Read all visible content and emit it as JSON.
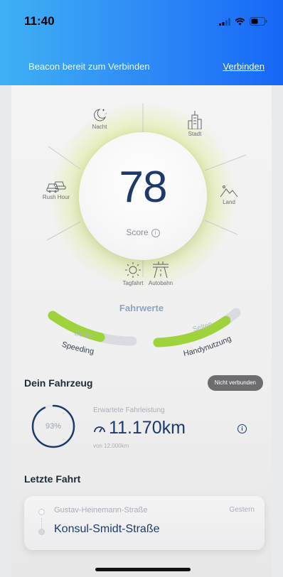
{
  "status_bar": {
    "time": "11:40"
  },
  "header": {
    "beacon_text": "Beacon bereit zum Verbinden",
    "connect_label": "Verbinden"
  },
  "score": {
    "value": "78",
    "label": "Score"
  },
  "categories": {
    "night": "Nacht",
    "city": "Stadt",
    "rush_hour": "Rush Hour",
    "land": "Land",
    "day": "Tagfahrt",
    "highway": "Autobahn"
  },
  "fahrwerte": {
    "title": "Fahrwerte",
    "speeding": {
      "label": "Speeding",
      "rating": "Selten",
      "level": 0.62
    },
    "phone_usage": {
      "label": "Handynutzung",
      "rating": "Selten",
      "level": 0.85
    }
  },
  "vehicle": {
    "title": "Dein Fahrzeug",
    "status_badge": "Nicht verbunden",
    "progress_percent_label": "93%",
    "progress": 0.93,
    "expected_label": "Erwartete Fahrleistung",
    "expected_value": "11.170km",
    "expected_sub": "von 12.000km"
  },
  "last_trip": {
    "title": "Letzte Fahrt",
    "from": "Gustav-Heinemann-Straße",
    "to": "Konsul-Smidt-Straße",
    "when": "Gestern"
  },
  "colors": {
    "accent": "#1d3a6b",
    "green": "#9fd33b",
    "header_start": "#3fb1f4",
    "header_end": "#1667f6"
  }
}
